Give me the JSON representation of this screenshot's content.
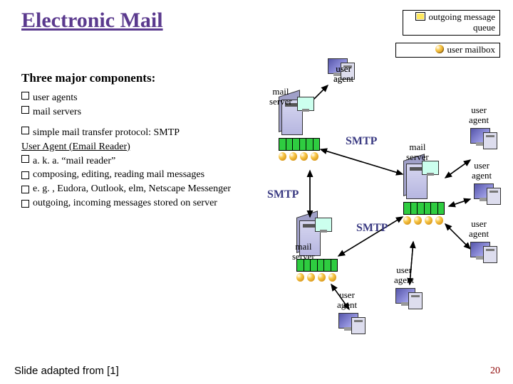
{
  "title": "Electronic Mail",
  "subtitle": "Three major components:",
  "bullets": {
    "b1": "user agents",
    "b2": "mail servers",
    "b3": "simple mail transfer protocol: SMTP",
    "heading": "User Agent (Email Reader)",
    "b4": "a. k. a. “mail reader”",
    "b5": "composing, editing, reading mail messages",
    "b6": "e. g. , Eudora, Outlook, elm, Netscape Messenger",
    "b7": "outgoing, incoming messages stored on server"
  },
  "legend": {
    "queue": "outgoing message queue",
    "mailbox": "user mailbox"
  },
  "labels": {
    "user_agent": "user\nagent",
    "mail_server": "mail\nserver",
    "smtp": "SMTP"
  },
  "footer": "Slide adapted from [1]",
  "page": "20"
}
